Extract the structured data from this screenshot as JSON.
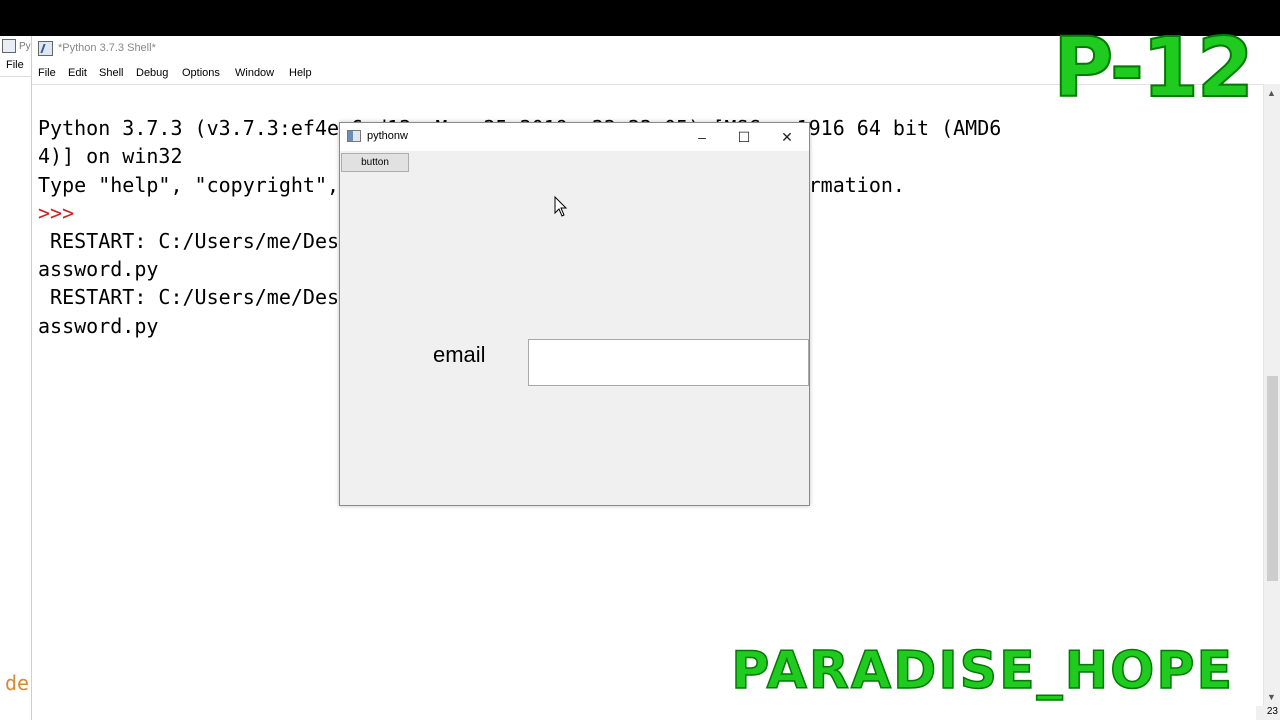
{
  "background_window": {
    "title_fragment": "Py",
    "menu_fragment": "File",
    "text_fragment": "de"
  },
  "shell": {
    "title": "*Python 3.7.3 Shell*",
    "menu": [
      "File",
      "Edit",
      "Shell",
      "Debug",
      "Options",
      "Window",
      "Help"
    ],
    "lines": [
      "Python 3.7.3 (v3.7.3:ef4ec6ed12, Mar 25 2019, 22:22:05) [MSC v.1916 64 bit (AMD6",
      "4)] on win32",
      "Type \"help\", \"copyright\", \"credits\" or \"license()\" for more information.",
      ">>> ",
      " RESTART: C:/Users/me/Desktop/qt designer/youtube code/pyqt5 p",
      "assword.py",
      "",
      " RESTART: C:/Users/me/Desktop/qt designer/youtube code/pyqt5 p",
      "assword.py"
    ],
    "status_text": "23"
  },
  "popup": {
    "title": "pythonw",
    "minimize": "–",
    "maximize": "☐",
    "close": "✕",
    "button_label": "button",
    "email_label": "email",
    "email_value": ""
  },
  "overlay": {
    "episode": "P-12",
    "brand": "PARADISE_HOPE"
  },
  "colors": {
    "prompt": "#cc2222",
    "overlay_green": "#1ecb1e"
  }
}
